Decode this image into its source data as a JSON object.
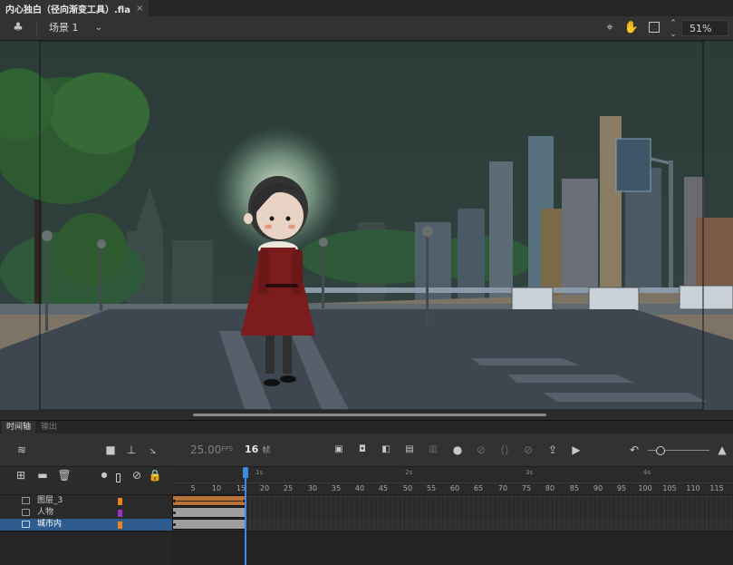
{
  "document_tab": {
    "title": "内心独白（径向渐变工具）.fla",
    "close": "×"
  },
  "scene_bar": {
    "scene_label": "场景 1",
    "zoom_value": "51%"
  },
  "panel_tabs": {
    "timeline": "时间轴",
    "output": "输出"
  },
  "timeline_toolbar": {
    "fps_value": "25.00",
    "fps_unit": "FPS",
    "current_frame": "16",
    "frame_unit": "帧"
  },
  "ruler": {
    "frame_numbers": [
      "5",
      "10",
      "15",
      "20",
      "25",
      "30",
      "35",
      "40",
      "45",
      "50",
      "55",
      "60",
      "65",
      "70",
      "75",
      "80",
      "85",
      "90",
      "95",
      "100",
      "105",
      "110",
      "115"
    ],
    "second_marks": [
      "1s",
      "2s",
      "3s",
      "4s"
    ]
  },
  "layers": [
    {
      "name": "图层_3",
      "color": "#e8821e",
      "selected": false
    },
    {
      "name": "人物",
      "color": "#9b34c4",
      "selected": false
    },
    {
      "name": "城市内",
      "color": "#e8821e",
      "selected": true
    }
  ],
  "colors": {
    "accent": "#3b8ae6",
    "tween_span": "#b8733a",
    "static_span": "#9e9e9e",
    "selected_layer": "#2f5c8f"
  },
  "icons": {
    "scene": "club-icon",
    "edit_scene": "chevron-down-icon",
    "center": "crosshair-icon",
    "hand": "hand-icon",
    "clip": "frame-icon",
    "zoom_spin": "spinner-icon",
    "layers": "layers-icon",
    "camera": "camera-icon",
    "parenting": "hierarchy-icon",
    "graph": "graph-icon",
    "undo": "undo-icon",
    "play": "play-icon"
  }
}
